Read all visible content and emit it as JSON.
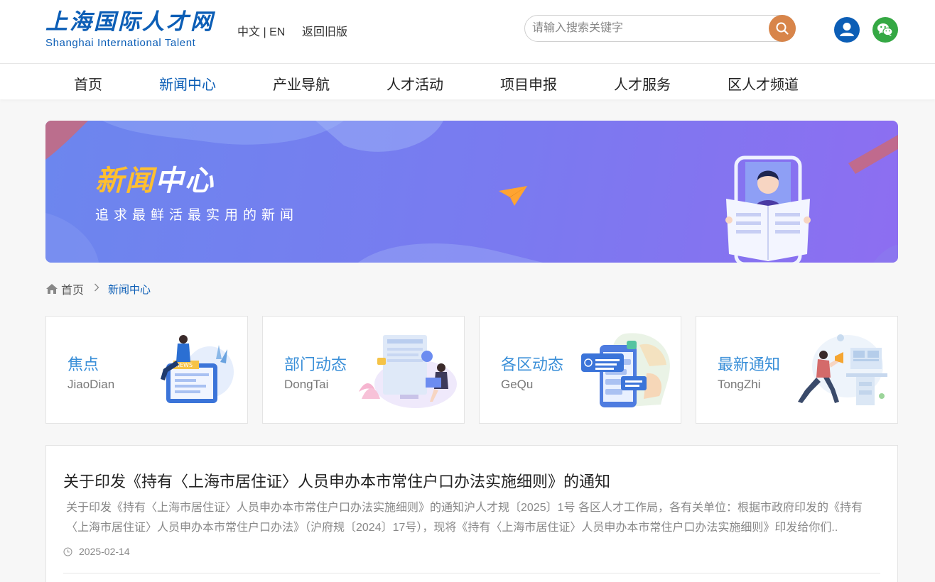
{
  "header": {
    "logo_cn": "上海国际人才网",
    "logo_en": "Shanghai International Talent",
    "lang_cn": "中文",
    "lang_sep": "|",
    "lang_en": "EN",
    "old_version": "返回旧版",
    "search_placeholder": "请输入搜索关键字"
  },
  "nav": [
    "首页",
    "新闻中心",
    "产业导航",
    "人才活动",
    "项目申报",
    "人才服务",
    "区人才频道"
  ],
  "nav_active": "新闻中心",
  "banner": {
    "title_part1": "新闻",
    "title_part2": "中心",
    "subtitle": "追求最鲜活最实用的新闻"
  },
  "breadcrumb": {
    "home": "首页",
    "current": "新闻中心"
  },
  "categories": [
    {
      "title": "焦点",
      "subtitle": "JiaoDian",
      "icon": "newspaper-reader-illustration"
    },
    {
      "title": "部门动态",
      "subtitle": "DongTai",
      "icon": "office-worker-illustration"
    },
    {
      "title": "各区动态",
      "subtitle": "GeQu",
      "icon": "phone-chat-map-illustration"
    },
    {
      "title": "最新通知",
      "subtitle": "TongZhi",
      "icon": "megaphone-illustration"
    }
  ],
  "news": {
    "title": "关于印发《持有〈上海市居住证〉人员申办本市常住户口办法实施细则》的通知",
    "excerpt": "关于印发《持有〈上海市居住证〉人员申办本市常住户口办法实施细则》的通知沪人才规〔2025〕1号 各区人才工作局，各有关单位：根据市政府印发的《持有〈上海市居住证〉人员申办本市常住户口办法》（沪府规〔2024〕17号），现将《持有〈上海市居住证〉人员申办本市常住户口办法实施细则》印发给你们..",
    "date": "2025-02-14"
  },
  "colors": {
    "brand_blue": "#0c5eb6",
    "search_orange": "#d8854a",
    "wechat_green": "#35a844",
    "banner_highlight": "#ffbf2f",
    "card_title": "#3a8fd8"
  }
}
